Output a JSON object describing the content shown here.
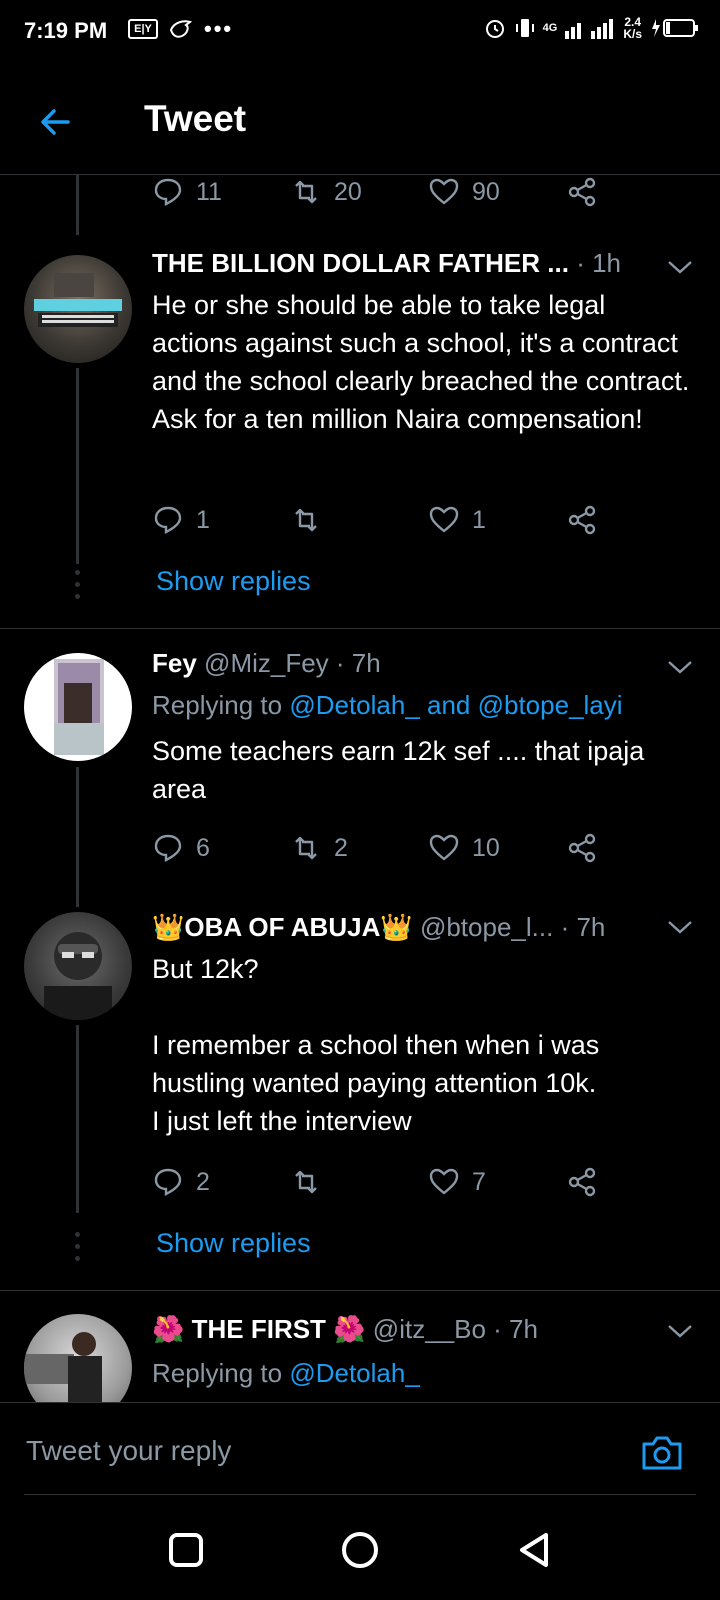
{
  "status_bar": {
    "time": "7:19 PM",
    "left_icon_badge": "E|Y",
    "overflow": "•••",
    "network": "4G",
    "speed_value": "2.4",
    "speed_unit": "K/s"
  },
  "header": {
    "title": "Tweet"
  },
  "top_actions": {
    "replies": "11",
    "retweets": "20",
    "likes": "90"
  },
  "tweets": [
    {
      "name": "THE BILLION DOLLAR FATHER ...",
      "handle": "",
      "time": "· 1h",
      "body": "He or she should be able to take legal actions against such a school, it's a contract and the school clearly breached the contract. Ask for a ten million Naira compensation!",
      "replies": "1",
      "retweets": "",
      "likes": "1",
      "show_replies": "Show replies"
    },
    {
      "name": "Fey",
      "handle": "@Miz_Fey",
      "time": "· 7h",
      "reply_prefix": "Replying to",
      "reply_mentions": "@Detolah_ and @btope_layi",
      "body": "Some teachers earn 12k sef .... that ipaja area",
      "replies": "6",
      "retweets": "2",
      "likes": "10"
    },
    {
      "name_emoji_left": "👑",
      "name": "OBA OF ABUJA",
      "name_emoji_right": "👑",
      "handle": "@btope_l...",
      "time": "· 7h",
      "body": "But 12k?\n\nI remember a school then when i was hustling wanted paying attention 10k.\nI just left the interview",
      "replies": "2",
      "retweets": "",
      "likes": "7",
      "show_replies": "Show replies"
    },
    {
      "name_emoji_left": "🌺",
      "name": "THE FIRST",
      "name_emoji_right": "🌺",
      "handle": "@itz__Bo",
      "time": "· 7h",
      "reply_prefix": "Replying to",
      "reply_mentions": "@Detolah_"
    }
  ],
  "composer": {
    "placeholder": "Tweet your reply"
  },
  "colors": {
    "accent": "#1d9bf0",
    "muted": "#8b98a5",
    "divider": "#2f3336",
    "background": "#000000"
  }
}
